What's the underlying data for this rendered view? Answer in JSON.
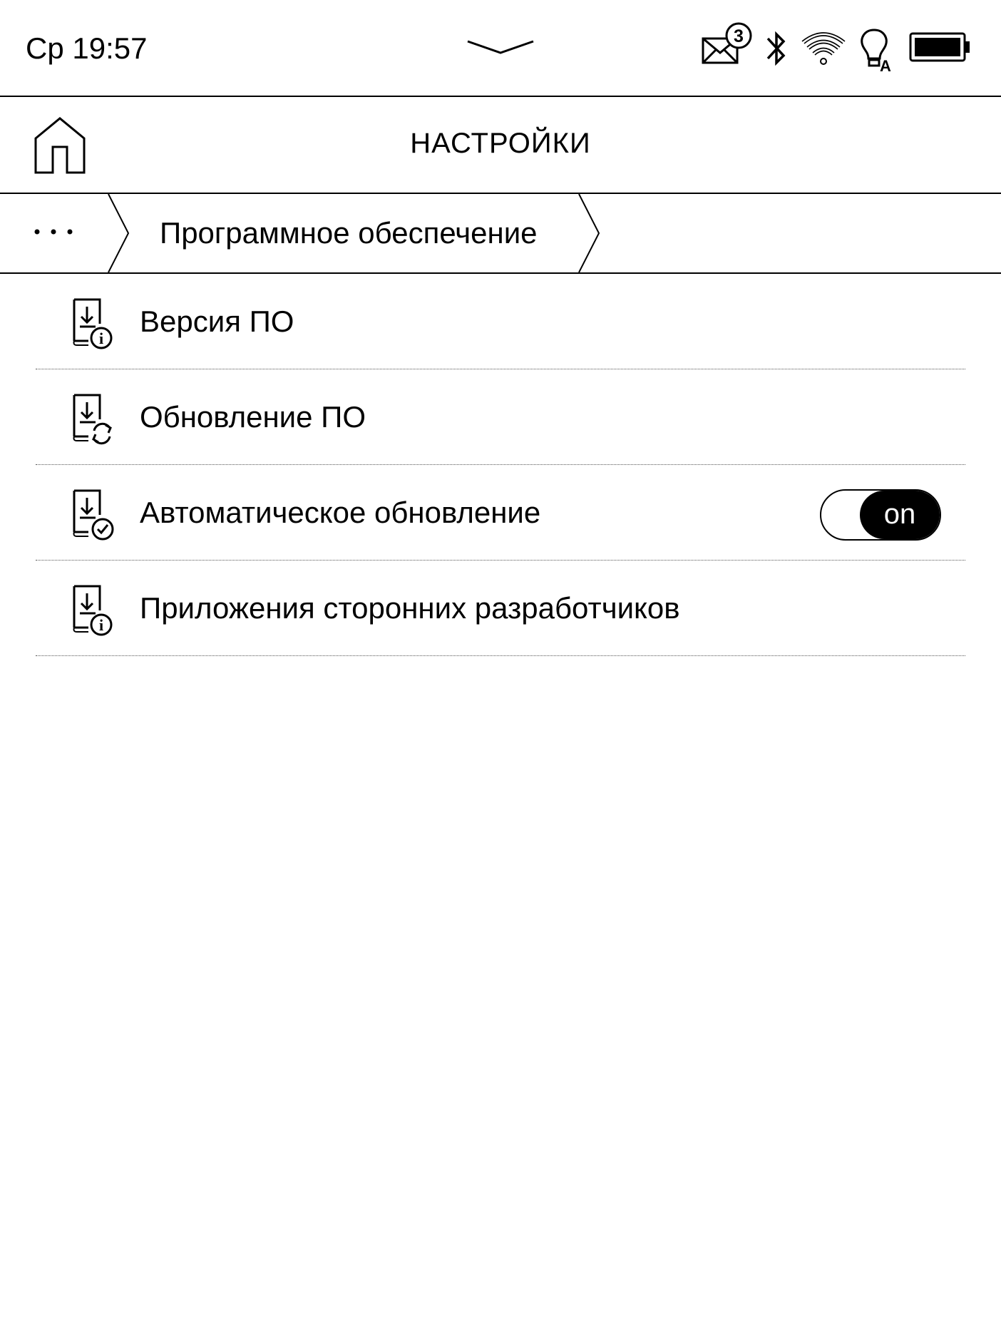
{
  "status_bar": {
    "time": "Ср 19:57",
    "unread_mail_count": "3",
    "icons": [
      "pulldown-chevron-icon",
      "mail-icon",
      "bluetooth-icon",
      "wifi-icon",
      "frontlight-auto-icon",
      "battery-icon"
    ]
  },
  "header": {
    "title": "НАСТРОЙКИ",
    "home_icon": "home-icon"
  },
  "breadcrumb": {
    "more_icon": "ellipsis-icon",
    "current": "Программное обеспечение"
  },
  "settings": {
    "items": [
      {
        "label": "Версия ПО",
        "icon": "software-info-icon"
      },
      {
        "label": "Обновление ПО",
        "icon": "software-update-icon"
      },
      {
        "label": "Автоматическое обновление",
        "icon": "software-auto-update-icon",
        "toggle": "on"
      },
      {
        "label": "Приложения сторонних разработчиков",
        "icon": "software-info-icon"
      }
    ]
  }
}
